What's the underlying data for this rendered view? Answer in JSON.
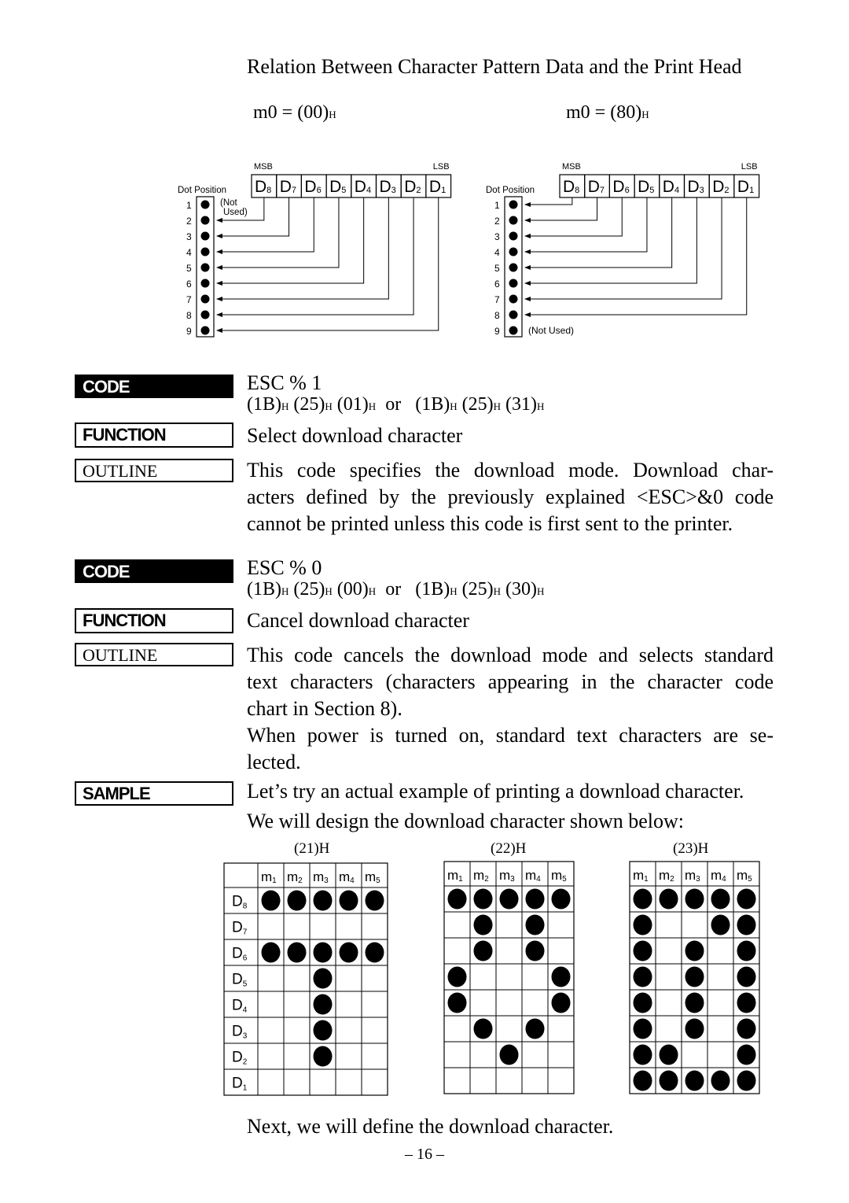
{
  "title": "Relation Between Character Pattern Data and the Print Head",
  "diagrams": [
    {
      "mode_label": "m0 = (00)",
      "mode_suffix": "H",
      "msb": "MSB",
      "lsb": "LSB",
      "dot_position_label": "Dot Position",
      "bits": [
        "D8",
        "D7",
        "D6",
        "D5",
        "D4",
        "D3",
        "D2",
        "D1"
      ],
      "bit_to_dot": [
        2,
        3,
        4,
        5,
        6,
        7,
        8,
        9
      ],
      "not_used_dot": 1,
      "not_used_label": "(Not Used)"
    },
    {
      "mode_label": "m0 = (80)",
      "mode_suffix": "H",
      "msb": "MSB",
      "lsb": "LSB",
      "dot_position_label": "Dot Position",
      "bits": [
        "D8",
        "D7",
        "D6",
        "D5",
        "D4",
        "D3",
        "D2",
        "D1"
      ],
      "bit_to_dot": [
        1,
        2,
        3,
        4,
        5,
        6,
        7,
        8
      ],
      "not_used_dot": 9,
      "not_used_label": "(Not Used)"
    }
  ],
  "dot_numbers": [
    "1",
    "2",
    "3",
    "4",
    "5",
    "6",
    "7",
    "8",
    "9"
  ],
  "labels": {
    "code": "CODE",
    "function": "FUNCTION",
    "outline": "OUTLINE",
    "sample": "SAMPLE"
  },
  "sections": [
    {
      "code": "ESC % 1",
      "hex_a": [
        "1B",
        "25",
        "01"
      ],
      "or": "or",
      "hex_b": [
        "1B",
        "25",
        "31"
      ],
      "suffix": "H",
      "function": "Select download character",
      "outline": [
        "This code specifies the download mode. Download char-",
        "acters defined by the previously explained <ESC>&0 code",
        "cannot be printed unless this code is first sent to the printer."
      ]
    },
    {
      "code": "ESC % 0",
      "hex_a": [
        "1B",
        "25",
        "00"
      ],
      "or": "or",
      "hex_b": [
        "1B",
        "25",
        "30"
      ],
      "suffix": "H",
      "function": "Cancel download character",
      "outline": [
        "This code cancels the download mode and selects standard",
        "text characters (characters appearing in the character code",
        "chart in Section 8).",
        "When power is turned on, standard text characters are se-",
        "lected."
      ]
    }
  ],
  "sample": {
    "line1": "Let’s try an actual example of printing a download character.",
    "line2": "We will design the download character shown below:",
    "closing": "Next, we will define the download character."
  },
  "grids": {
    "columns": [
      "m1",
      "m2",
      "m3",
      "m4",
      "m5"
    ],
    "rows": [
      "D8",
      "D7",
      "D6",
      "D5",
      "D4",
      "D3",
      "D2",
      "D1"
    ],
    "characters": [
      {
        "code": "(21)H",
        "pattern": [
          "11111",
          "00000",
          "11111",
          "00100",
          "00100",
          "00100",
          "00100",
          "00000"
        ]
      },
      {
        "code": "(22)H",
        "pattern": [
          "11111",
          "01010",
          "01010",
          "10001",
          "10001",
          "01010",
          "00100",
          "00000"
        ]
      },
      {
        "code": "(23)H",
        "pattern": [
          "11111",
          "10011",
          "10101",
          "10101",
          "10101",
          "10101",
          "11001",
          "11111"
        ]
      }
    ]
  },
  "page_number": "– 16 –"
}
